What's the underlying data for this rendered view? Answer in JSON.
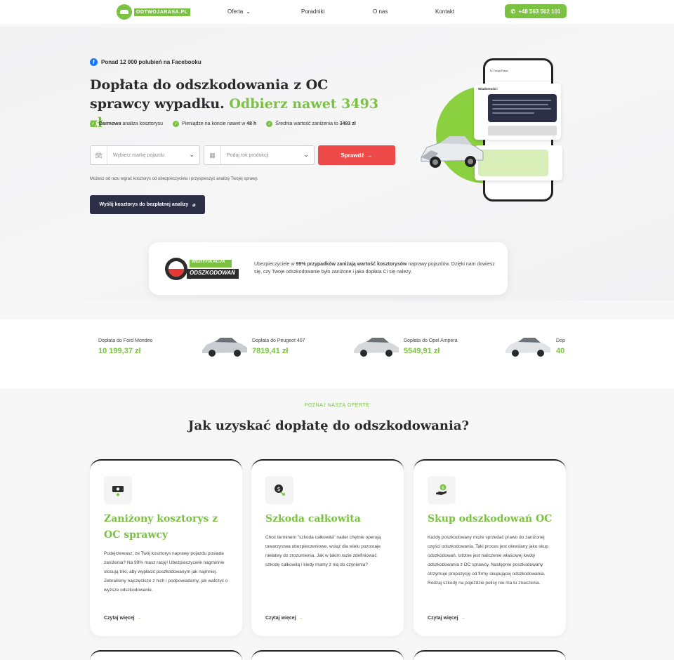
{
  "nav": {
    "logo_text": "ODTWOJARASA.PL",
    "links": [
      "Oferta",
      "Poradniki",
      "O nas",
      "Kontakt"
    ],
    "phone": "+48 563 502 101"
  },
  "hero": {
    "fb_text": "Ponad 12 000 polubień na Facebooku",
    "title_main": "Dopłata do odszkodowania z OC sprawcy wypadku. ",
    "title_accent": "Odbierz nawet 3493 zł",
    "checks": [
      {
        "bold": "Darmowa",
        "rest": " analiza kosztorysu"
      },
      {
        "bold": "",
        "rest": "Pieniądze na koncie nawet w ",
        "bold2": "48 h"
      },
      {
        "bold": "",
        "rest": "Średnia wartość zaniżenia to ",
        "bold2": "3493 zł"
      }
    ],
    "brand_placeholder": "Wybierz markę pojazdu",
    "year_placeholder": "Podaj rok produkcji",
    "check_button": "Sprawdź",
    "note": "Możesz od razu wgrać kosztorys od ubezpieczyciela i przyspieszyć analizę Twojej sprawy.",
    "send_button": "Wyślij kosztorys do bezpłatnej analizy"
  },
  "phone_mock": {
    "app_title": "Tu Twoja Rasa",
    "messages_label": "Wiadomości:"
  },
  "verify": {
    "badge_top": "WERYFIKACJA",
    "badge_bottom": "ODSZKODOWAŃ",
    "text_pre": "Ubezpieczyciele w ",
    "text_bold": "99% przypadków zaniżają wartość kosztorysów",
    "text_post": " naprawy pojazdów. Dzięki nam dowiesz się, czy Twoje odszkodowanie było zaniżone i jaka dopłata Ci się należy."
  },
  "cars": [
    {
      "label": "Dopłata do Ford Mondeo",
      "value": "10 199,37 zł"
    },
    {
      "label": "Dopłata do Peugeot 407",
      "value": "7819,41 zł"
    },
    {
      "label": "Dopłata do Opel Ampera",
      "value": "5549,91 zł"
    },
    {
      "label": "Dop",
      "value": "40"
    }
  ],
  "offer": {
    "eyebrow": "POZNAJ NASZĄ OFERTĘ",
    "title": "Jak uzyskać dopłatę do odszkodowania?",
    "cards": [
      {
        "title": "Zaniżony kosztorys z OC sprawcy",
        "text": "Podejrzewasz, że Twój kosztorys naprawy pojazdu posiada zaniżenia? Na 99% masz rację! Ubezpieczyciele nagminnie stosują triki, aby wypłacić poszkodowanym jak najmniej. Zebraliśmy najczęstsze z nich i podpowiadamy, jak walczyć o wyższe odszkodowanie.",
        "link": "Czytaj więcej"
      },
      {
        "title": "Szkoda całkowita",
        "text": "Choć terminem \"szkoda całkowita\" nader chętnie operują towarzystwa ubezpieczeniowe, wciąż dla wielu pozostaje niełatwy do zrozumienia. Jak w takim razie zdefiniować szkodę całkowitą i kiedy mamy z nią do czynienia?",
        "link": "Czytaj więcej"
      },
      {
        "title": "Skup odszkodowań OC",
        "text": "Każdy poszkodowany może sprzedać prawo do zaniżonej części odszkodowania. Taki proces jest określany jako skup odszkodowań. Istotne jest naliczenie właściwej kwoty odszkodowania z OC sprawcy. Następnie poszkodowany otrzymuje propozycję od firmy skupującej odszkodowania. Rodzaj szkody na pojeździe polisy nie ma tu znaczenia.",
        "link": "Czytaj więcej"
      }
    ]
  },
  "colors": {
    "accent": "#7cc242",
    "cta": "#ef4a4a",
    "dark": "#2c2f45"
  }
}
